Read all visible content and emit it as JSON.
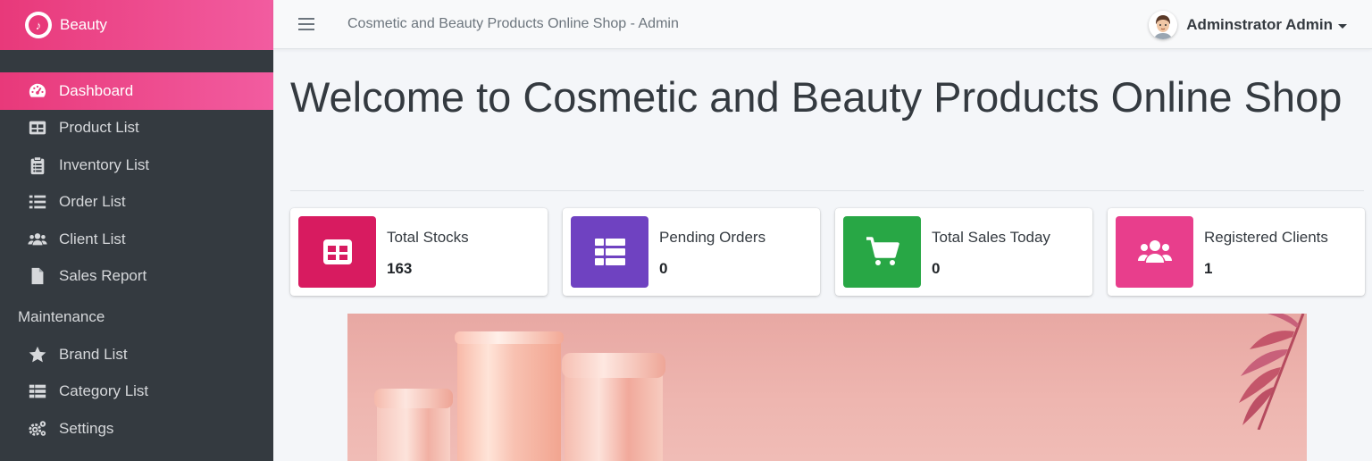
{
  "brand": {
    "name": "Beauty"
  },
  "sidebar": {
    "items": [
      {
        "label": "Dashboard",
        "icon": "dashboard-icon",
        "active": true
      },
      {
        "label": "Product List",
        "icon": "table-icon"
      },
      {
        "label": "Inventory List",
        "icon": "clipboard-icon"
      },
      {
        "label": "Order List",
        "icon": "list-icon"
      },
      {
        "label": "Client List",
        "icon": "users-icon"
      },
      {
        "label": "Sales Report",
        "icon": "file-icon"
      }
    ],
    "maintenance_header": "Maintenance",
    "maintenance_items": [
      {
        "label": "Brand List",
        "icon": "star-icon"
      },
      {
        "label": "Category List",
        "icon": "th-list-icon"
      },
      {
        "label": "Settings",
        "icon": "cogs-icon"
      }
    ]
  },
  "header": {
    "title": "Cosmetic and Beauty Products Online Shop - Admin",
    "user_name": "Adminstrator Admin"
  },
  "main": {
    "welcome": "Welcome to Cosmetic and Beauty Products Online Shop",
    "cards": [
      {
        "label": "Total Stocks",
        "value": "163",
        "color": "#d81b60",
        "icon": "table-icon"
      },
      {
        "label": "Pending Orders",
        "value": "0",
        "color": "#6f42c1",
        "icon": "th-list-icon"
      },
      {
        "label": "Total Sales Today",
        "value": "0",
        "color": "#28a745",
        "icon": "cart-icon"
      },
      {
        "label": "Registered Clients",
        "value": "1",
        "color": "#e83e8c",
        "icon": "users-icon"
      }
    ]
  }
}
